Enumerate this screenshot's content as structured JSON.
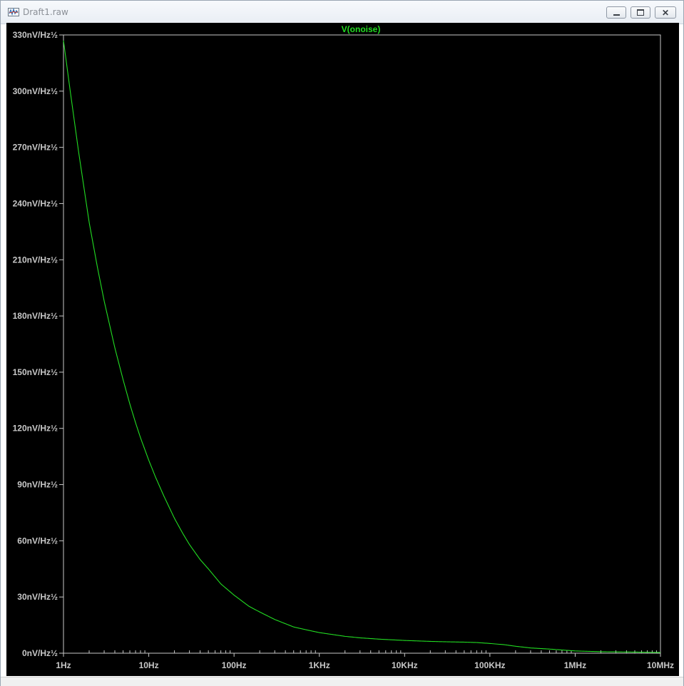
{
  "window": {
    "title": "Draft1.raw"
  },
  "colors": {
    "background": "#000000",
    "axis": "#c8c8c8",
    "trace": "#22dd22"
  },
  "chart_data": {
    "type": "line",
    "title": "V(onoise)",
    "xlabel": "",
    "ylabel": "",
    "xscale": "log",
    "xlim": [
      1,
      10000000
    ],
    "ylim": [
      0,
      330
    ],
    "grid": false,
    "x_ticks": [
      1,
      10,
      100,
      1000,
      10000,
      100000,
      1000000,
      10000000
    ],
    "x_tick_labels": [
      "1Hz",
      "10Hz",
      "100Hz",
      "1KHz",
      "10KHz",
      "100KHz",
      "1MHz",
      "10MHz"
    ],
    "y_ticks": [
      0,
      30,
      60,
      90,
      120,
      150,
      180,
      210,
      240,
      270,
      300,
      330
    ],
    "y_tick_labels": [
      "0nV/Hz½",
      "30nV/Hz½",
      "60nV/Hz½",
      "90nV/Hz½",
      "120nV/Hz½",
      "150nV/Hz½",
      "180nV/Hz½",
      "210nV/Hz½",
      "240nV/Hz½",
      "270nV/Hz½",
      "300nV/Hz½",
      "330nV/Hz½"
    ],
    "series": [
      {
        "name": "V(onoise)",
        "x": [
          1,
          1.2,
          1.5,
          2,
          2.5,
          3,
          4,
          5,
          6,
          7,
          8,
          10,
          12,
          15,
          20,
          25,
          30,
          40,
          50,
          70,
          100,
          150,
          200,
          300,
          500,
          700,
          1000,
          2000,
          3000,
          5000,
          10000,
          20000,
          30000,
          50000,
          70000,
          100000,
          150000,
          200000,
          300000,
          500000,
          1000000,
          2000000,
          5000000,
          10000000
        ],
        "y": [
          327,
          300,
          268,
          230,
          206,
          188,
          163,
          146,
          133,
          123,
          115,
          103,
          94,
          84,
          72,
          64,
          58,
          50,
          45,
          37,
          31,
          25,
          22,
          18,
          14,
          12.5,
          11,
          9,
          8.2,
          7.5,
          6.8,
          6.3,
          6.1,
          5.9,
          5.7,
          5.2,
          4.5,
          3.7,
          2.8,
          2.2,
          1.2,
          0.8,
          0.6,
          0.4
        ]
      }
    ]
  }
}
